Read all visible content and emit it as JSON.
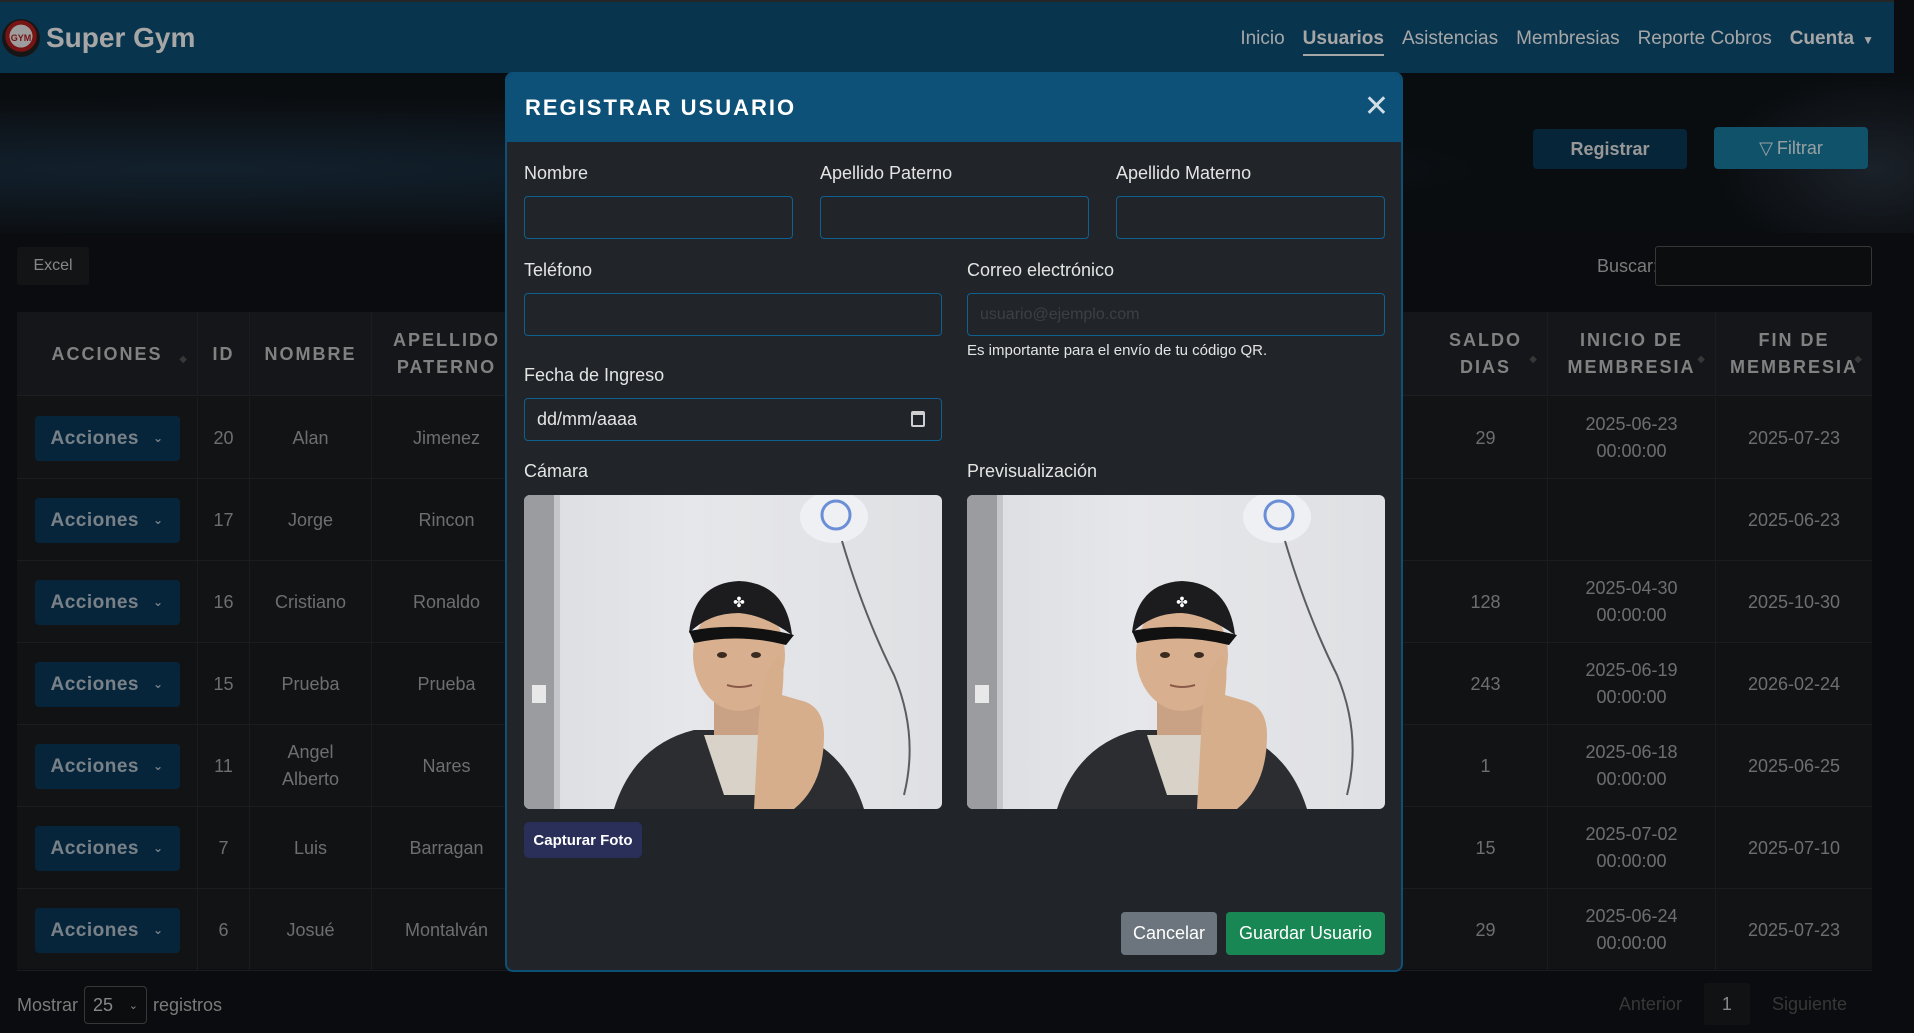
{
  "brand": {
    "name": "Super Gym",
    "logo_text": "GYM"
  },
  "nav": {
    "links": [
      "Inicio",
      "Usuarios",
      "Asistencias",
      "Membresias",
      "Reporte Cobros"
    ],
    "account": "Cuenta",
    "active": "Usuarios"
  },
  "toolbar": {
    "registrar": "Registrar",
    "filtrar": "Filtrar",
    "excel": "Excel",
    "search_label": "Buscar:"
  },
  "table": {
    "headers": {
      "acciones": "ACCIONES",
      "id": "ID",
      "nombre": "NOMBRE",
      "apellido_l1": "APELLIDO",
      "apellido_l2": "PATERNO",
      "saldo_l1": "SALDO",
      "saldo_l2": "DIAS",
      "inicio_l1": "INICIO DE",
      "inicio_l2": "MEMBRESIA",
      "fin_l1": "FIN DE",
      "fin_l2": "MEMBRESIA"
    },
    "action_label": "Acciones",
    "rows": [
      {
        "id": "20",
        "nombre": "Alan",
        "apellido": "Jimenez",
        "saldo": "29",
        "inicio_date": "2025-06-23",
        "inicio_time": "00:00:00",
        "fin": "2025-07-23"
      },
      {
        "id": "17",
        "nombre": "Jorge",
        "apellido": "Rincon",
        "saldo": "",
        "inicio_date": "",
        "inicio_time": "",
        "fin": "2025-06-23"
      },
      {
        "id": "16",
        "nombre": "Cristiano",
        "apellido": "Ronaldo",
        "saldo": "128",
        "inicio_date": "2025-04-30",
        "inicio_time": "00:00:00",
        "fin": "2025-10-30"
      },
      {
        "id": "15",
        "nombre": "Prueba",
        "apellido": "Prueba",
        "saldo": "243",
        "inicio_date": "2025-06-19",
        "inicio_time": "00:00:00",
        "fin": "2026-02-24"
      },
      {
        "id": "11",
        "nombre": "Angel Alberto",
        "apellido": "Nares",
        "saldo": "1",
        "inicio_date": "2025-06-18",
        "inicio_time": "00:00:00",
        "fin": "2025-06-25"
      },
      {
        "id": "7",
        "nombre": "Luis",
        "apellido": "Barragan",
        "saldo": "15",
        "inicio_date": "2025-07-02",
        "inicio_time": "00:00:00",
        "fin": "2025-07-10"
      },
      {
        "id": "6",
        "nombre": "Josué",
        "apellido": "Montalván",
        "saldo": "29",
        "inicio_date": "2025-06-24",
        "inicio_time": "00:00:00",
        "fin": "2025-07-23"
      }
    ]
  },
  "footer": {
    "mostrar": "Mostrar",
    "page_size": "25",
    "registros": "registros",
    "anterior": "Anterior",
    "current_page": "1",
    "siguiente": "Siguiente"
  },
  "modal": {
    "title": "REGISTRAR USUARIO",
    "fields": {
      "nombre": "Nombre",
      "apellido_paterno": "Apellido Paterno",
      "apellido_materno": "Apellido Materno",
      "telefono": "Teléfono",
      "correo": "Correo electrónico",
      "correo_placeholder": "usuario@ejemplo.com",
      "correo_hint": "Es importante para el envío de tu código QR.",
      "fecha_ingreso": "Fecha de Ingreso",
      "fecha_placeholder": "dd/mm/aaaa",
      "camara": "Cámara",
      "previsualizacion": "Previsualización"
    },
    "buttons": {
      "capturar": "Capturar Foto",
      "cancelar": "Cancelar",
      "guardar": "Guardar Usuario"
    }
  },
  "colors": {
    "navbar": "#0d5078",
    "accent": "#1b7fa5",
    "save": "#198754",
    "cancel": "#6c757d"
  },
  "icons": {
    "close": "close-icon",
    "filter": "filter-icon",
    "calendar": "calendar-icon"
  }
}
